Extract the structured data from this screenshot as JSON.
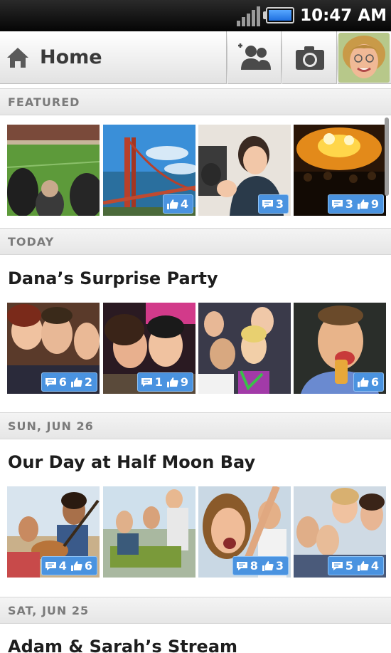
{
  "status_bar": {
    "time": "10:47 AM",
    "battery_color": "#2f7df0"
  },
  "action_bar": {
    "title": "Home",
    "icons": [
      "home-icon",
      "add-friend-icon",
      "camera-icon",
      "profile-avatar"
    ]
  },
  "sections": [
    {
      "header": "FEATURED",
      "title": "",
      "photos": [
        {
          "scene": "soccer-stadium",
          "comments": null,
          "likes": null
        },
        {
          "scene": "golden-gate-bridge",
          "comments": null,
          "likes": "4"
        },
        {
          "scene": "woman-with-phone",
          "comments": "3",
          "likes": null
        },
        {
          "scene": "concert-crowd",
          "comments": "3",
          "likes": "9"
        }
      ]
    },
    {
      "header": "TODAY",
      "title": "Dana’s Surprise Party",
      "photos": [
        {
          "scene": "friends-selfie",
          "comments": "6",
          "likes": "2"
        },
        {
          "scene": "party-hug",
          "comments": "1",
          "likes": "9"
        },
        {
          "scene": "dancing-crowd",
          "comments": null,
          "likes": null
        },
        {
          "scene": "man-eating",
          "comments": null,
          "likes": "6"
        }
      ]
    },
    {
      "header": "SUN, JUN 26",
      "title": "Our Day at Half Moon Bay",
      "photos": [
        {
          "scene": "beach-guitar",
          "comments": "4",
          "likes": "6"
        },
        {
          "scene": "beach-picnic",
          "comments": null,
          "likes": null
        },
        {
          "scene": "laughing-woman",
          "comments": "8",
          "likes": "3"
        },
        {
          "scene": "group-portrait",
          "comments": "5",
          "likes": "4"
        }
      ]
    },
    {
      "header": "SAT, JUN 25",
      "title": "Adam & Sarah’s Stream",
      "photos": []
    }
  ],
  "colors": {
    "badge": "#4a93e0",
    "section_header_text": "#7b7b7b",
    "title_text": "#1e1e1e"
  }
}
